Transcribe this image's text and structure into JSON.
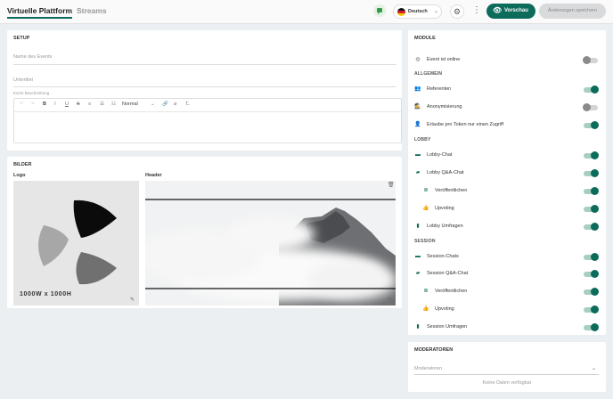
{
  "header": {
    "tabs": [
      {
        "label": "Virtuelle Plattform"
      },
      {
        "label": "Streams"
      }
    ],
    "language": {
      "label": "Deutsch"
    },
    "preview_label": "Vorschau",
    "save_label": "Änderungen speichern",
    "colors": {
      "primary": "#0d6b5b",
      "disabled": "#d8dadc"
    }
  },
  "setup": {
    "title": "SETUP",
    "event_name_placeholder": "Name des Events",
    "subtitle_placeholder": "Untertitel",
    "description_label": "Event Beschreibung",
    "toolbar": {
      "format_label": "Normal"
    }
  },
  "images": {
    "title": "BILDER",
    "logo_label": "Logo",
    "header_label": "Header",
    "logo_size": "1000W x 1000H"
  },
  "modules": {
    "title": "MODULE",
    "rows": [
      {
        "label": "Event ist online",
        "on": false,
        "icon": "globe-icon"
      },
      {
        "section": "ALLGEMEIN"
      },
      {
        "label": "Referenten",
        "on": true,
        "icon": "people-icon"
      },
      {
        "label": "Anonymisierung",
        "on": false,
        "icon": "incognito-icon"
      },
      {
        "label": "Erlaube pro Token nur einen Zugriff",
        "on": true,
        "icon": "person-add-icon"
      },
      {
        "section": "LOBBY"
      },
      {
        "label": "Lobby-Chat",
        "on": true,
        "icon": "chat-icon"
      },
      {
        "label": "Lobby Q&A-Chat",
        "on": true,
        "icon": "forum-icon"
      },
      {
        "label": "Veröffentlichen",
        "on": true,
        "icon": "publish-icon",
        "indent": true
      },
      {
        "label": "Upvoting",
        "on": true,
        "icon": "thumb-up-icon",
        "indent": true
      },
      {
        "label": "Lobby Umfragen",
        "on": true,
        "icon": "poll-icon"
      },
      {
        "section": "SESSION"
      },
      {
        "label": "Session-Chats",
        "on": true,
        "icon": "chat-icon"
      },
      {
        "label": "Session Q&A-Chat",
        "on": true,
        "icon": "forum-icon"
      },
      {
        "label": "Veröffentlichen",
        "on": true,
        "icon": "publish-icon",
        "indent": true
      },
      {
        "label": "Upvoting",
        "on": true,
        "icon": "thumb-up-icon",
        "indent": true
      },
      {
        "label": "Session Umfragen",
        "on": true,
        "icon": "poll-icon"
      }
    ]
  },
  "moderators": {
    "title": "MODERATOREN",
    "select_label": "Moderatoren",
    "empty_text": "Keine Daten verfügbar"
  }
}
